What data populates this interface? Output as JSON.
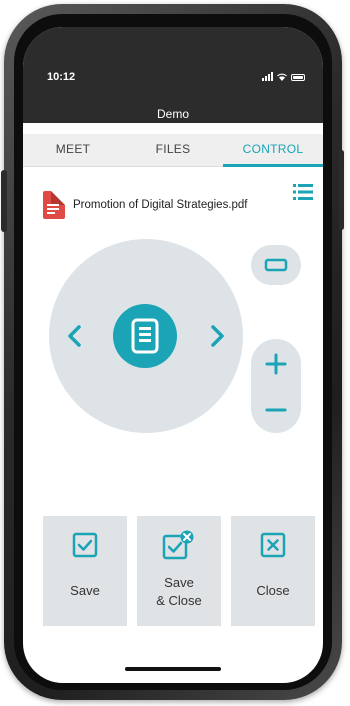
{
  "status_bar": {
    "time": "10:12",
    "icons": [
      "signal-icon",
      "wifi-icon",
      "battery-icon"
    ]
  },
  "app": {
    "title": "Demo"
  },
  "tabs": [
    {
      "label": "MEET",
      "active": false
    },
    {
      "label": "FILES",
      "active": false
    },
    {
      "label": "CONTROL",
      "active": true
    }
  ],
  "file": {
    "name": "Promotion of Digital Strategies.pdf",
    "icon": "pdf-file-icon"
  },
  "controls": {
    "icons": [
      "chevron-left-icon",
      "document-icon",
      "chevron-right-icon",
      "fit-screen-icon",
      "plus-icon",
      "minus-icon",
      "list-icon"
    ]
  },
  "actions": {
    "save": {
      "label": "Save",
      "icon": "checkbox-icon"
    },
    "save_close": {
      "label": "Save\n& Close",
      "icon": "checkbox-close-icon"
    },
    "close": {
      "label": "Close",
      "icon": "close-box-icon"
    }
  },
  "colors": {
    "accent": "#1ba3b6",
    "pdf_red": "#e04a45",
    "control_bg": "#dde3e6",
    "status_bar": "#2c2c2c"
  }
}
